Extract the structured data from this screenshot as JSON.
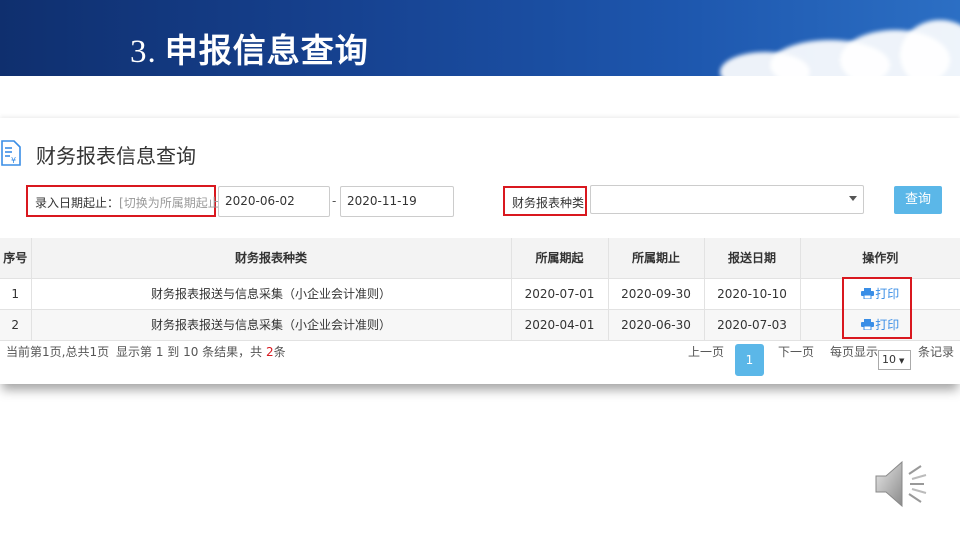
{
  "slide": {
    "number": "3.",
    "title": "申报信息查询"
  },
  "panel": {
    "title": "财务报表信息查询"
  },
  "filters": {
    "date_label": "录入日期起止：",
    "date_switch": "[切换为所属期起止]",
    "date_from": "2020-06-02",
    "date_separator": "-",
    "date_to": "2020-11-19",
    "type_label": "财务报表种类",
    "type_value": "",
    "query_button": "查询"
  },
  "table": {
    "headers": [
      "序号",
      "财务报表种类",
      "所属期起",
      "所属期止",
      "报送日期",
      "操作列"
    ],
    "rows": [
      {
        "no": "1",
        "type": "财务报表报送与信息采集（小企业会计准则）",
        "start": "2020-07-01",
        "end": "2020-09-30",
        "date": "2020-10-10",
        "action": "打印"
      },
      {
        "no": "2",
        "type": "财务报表报送与信息采集（小企业会计准则）",
        "start": "2020-04-01",
        "end": "2020-06-30",
        "date": "2020-07-03",
        "action": "打印"
      }
    ]
  },
  "pagination": {
    "page_info": "当前第1页,总共1页",
    "result_prefix": "显示第 1 到 10 条结果，共 ",
    "total": "2",
    "result_suffix": "条",
    "prev": "上一页",
    "current": "1",
    "next": "下一页",
    "per_page_label": "每页显示",
    "per_page": "10",
    "per_page_suffix": "条记录"
  },
  "colors": {
    "highlight": "#d9181f",
    "accent": "#5bb7e8",
    "link": "#3a8ee6",
    "banner": "#16418f"
  },
  "icons": [
    "document-yen-icon",
    "printer-icon",
    "speaker-icon",
    "dropdown-caret-icon"
  ]
}
